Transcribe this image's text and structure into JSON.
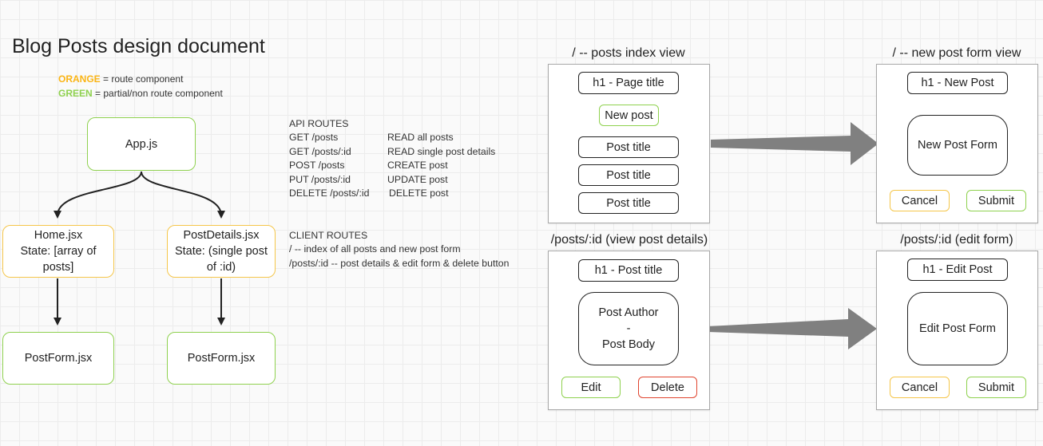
{
  "title": "Blog Posts design document",
  "legend": [
    {
      "key": "ORANGE",
      "text": " = route component",
      "color": "#fbb514"
    },
    {
      "key": "GREEN",
      "text": " = partial/non route component",
      "color": "#8fd14f"
    }
  ],
  "tree": {
    "app": "App.js",
    "home": [
      "Home.jsx",
      "State: [array of",
      "posts]"
    ],
    "details": [
      "PostDetails.jsx",
      "State: (single post",
      "of :id)"
    ],
    "postform_left": "PostForm.jsx",
    "postform_right": "PostForm.jsx"
  },
  "api_routes": {
    "heading": "API ROUTES",
    "rows": [
      {
        "route": "GET /posts",
        "desc": "READ all posts"
      },
      {
        "route": "GET /posts/:id",
        "desc": "READ single post details"
      },
      {
        "route": "POST /posts",
        "desc": "CREATE post"
      },
      {
        "route": "PUT /posts/:id",
        "desc": "UPDATE post"
      },
      {
        "route": "DELETE /posts/:id",
        "desc": "DELETE post"
      }
    ]
  },
  "client_routes": {
    "heading": "CLIENT ROUTES",
    "rows": [
      "/ -- index of all posts and new post form",
      "/posts/:id -- post details & edit form & delete button"
    ]
  },
  "panels": {
    "index": {
      "title": "/ -- posts index view",
      "h1": "h1 - Page title",
      "new_post": "New post",
      "posts": [
        "Post title",
        "Post title",
        "Post title"
      ]
    },
    "new_form": {
      "title": "/ -- new post form view",
      "h1": "h1 - New Post",
      "form": "New Post Form",
      "cancel": "Cancel",
      "submit": "Submit"
    },
    "details": {
      "title": "/posts/:id (view post details)",
      "h1": "h1 -  Post title",
      "body": [
        "Post Author",
        "-",
        "Post Body"
      ],
      "edit": "Edit",
      "delete": "Delete"
    },
    "edit_form": {
      "title": "/posts/:id (edit form)",
      "h1": "h1 -  Edit Post",
      "form": "Edit Post Form",
      "cancel": "Cancel",
      "submit": "Submit"
    }
  },
  "colors": {
    "orange": "#f5c64a",
    "green": "#8fd14f",
    "red": "#e0452f",
    "arrow": "#808080"
  }
}
